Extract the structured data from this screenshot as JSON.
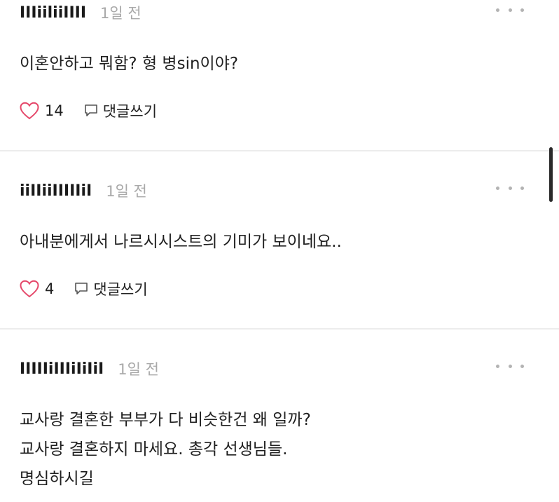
{
  "comments": [
    {
      "author": "IIIiiliiIIII",
      "time": "1일 전",
      "text": "이혼안하고 뭐함? 형 병sin이야?",
      "likes": "14",
      "reply_label": "댓글쓰기"
    },
    {
      "author": "iiIIiiIIIIIiI",
      "time": "1일 전",
      "text": "아내분에게서 나르시시스트의 기미가 보이네요..",
      "likes": "4",
      "reply_label": "댓글쓰기"
    },
    {
      "author": "IIIIIiIIIiIiIiI",
      "time": "1일 전",
      "text": "교사랑 결혼한 부부가 다 비슷한건 왜 일까?\n교사랑 결혼하지 마세요. 총각 선생님들.\n명심하시길"
    }
  ],
  "colors": {
    "heart": "#e5486a",
    "muted": "#a9a9a9",
    "divider": "#ececec",
    "scrollbar": "#2a2a2a"
  },
  "icons": {
    "like": "heart-outline-icon",
    "reply": "speech-bubble-icon",
    "more": "more-dots-icon"
  }
}
